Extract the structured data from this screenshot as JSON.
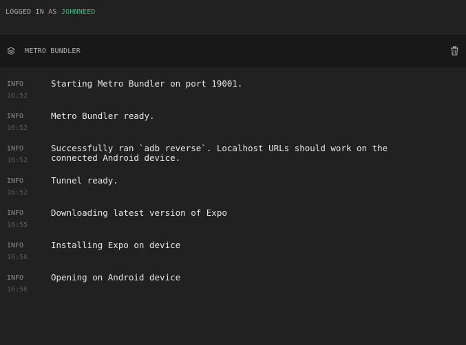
{
  "topbar": {
    "login_prefix": "LOGGED IN AS ",
    "username": "JOHNNEED"
  },
  "panel": {
    "title": "METRO BUNDLER",
    "icon": "layers-icon",
    "clear_icon": "trash-icon"
  },
  "logs": [
    {
      "level": "INFO",
      "time": "16:52",
      "message": "Starting Metro Bundler on port 19001."
    },
    {
      "level": "INFO",
      "time": "16:52",
      "message": "Metro Bundler ready."
    },
    {
      "level": "INFO",
      "time": "16:52",
      "message": "Successfully ran `adb reverse`. Localhost URLs should work on the\nconnected Android device."
    },
    {
      "level": "INFO",
      "time": "16:52",
      "message": "Tunnel ready."
    },
    {
      "level": "INFO",
      "time": "16:55",
      "message": "Downloading latest version of Expo"
    },
    {
      "level": "INFO",
      "time": "16:56",
      "message": "Installing Expo on device"
    },
    {
      "level": "INFO",
      "time": "16:56",
      "message": "Opening on Android device"
    }
  ],
  "colors": {
    "background": "#212121",
    "header": "#181818",
    "accent": "#2ec27e",
    "text": "#e6e6e6"
  }
}
